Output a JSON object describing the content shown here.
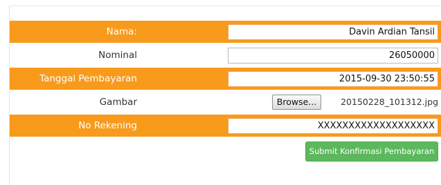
{
  "form": {
    "nama": {
      "label": "Nama:",
      "value": "Davin Ardian Tansil"
    },
    "nominal": {
      "label": "Nominal",
      "value": "26050000"
    },
    "tanggal": {
      "label": "Tanggal Pembayaran",
      "value": "2015-09-30 23:50:55"
    },
    "gambar": {
      "label": "Gambar",
      "browse_label": "Browse...",
      "file_name": "20150228_101312.jpg"
    },
    "rekening": {
      "label": "No Rekening",
      "value": "XXXXXXXXXXXXXXXXXXX"
    },
    "submit_label": "Submit Konfirmasi Pembayaran"
  },
  "colors": {
    "row_accent": "#f89a1c",
    "submit": "#5cb85c"
  }
}
